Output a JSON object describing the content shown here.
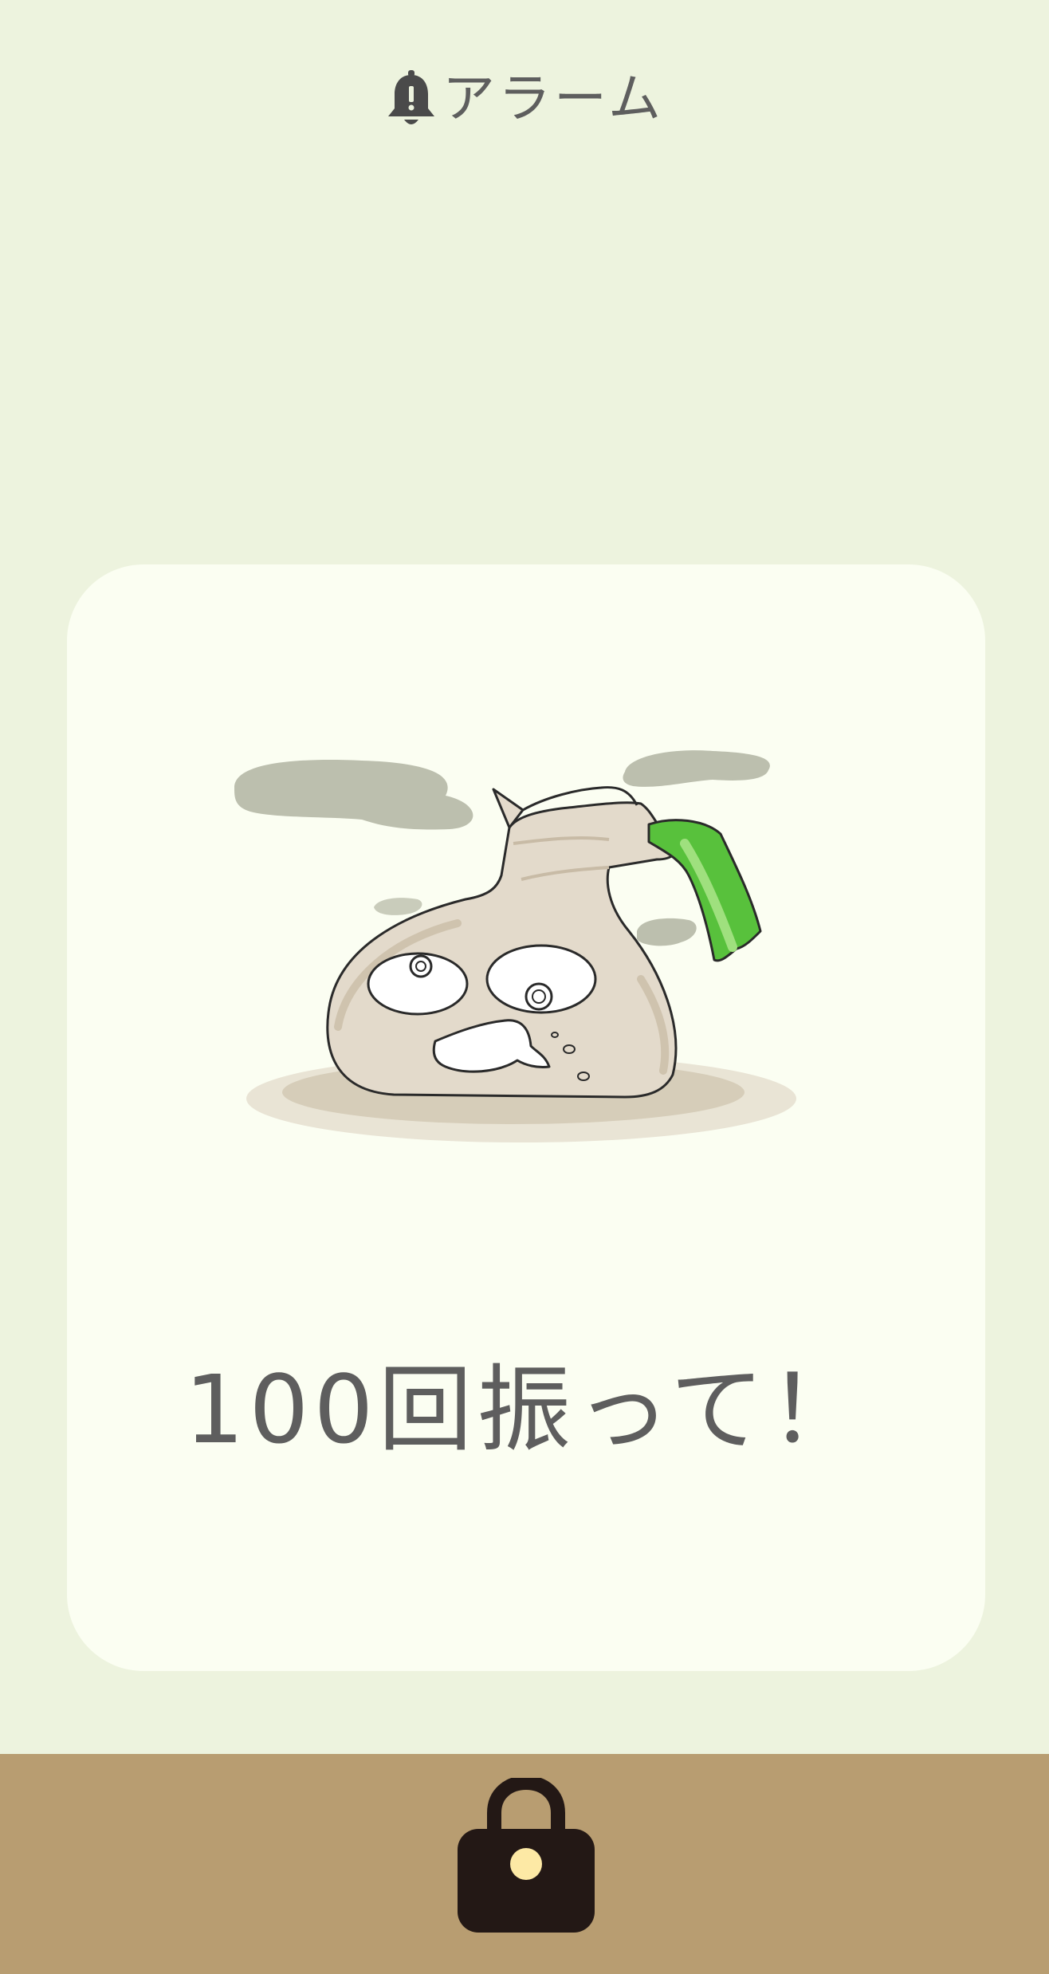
{
  "header": {
    "icon": "bell-alert-icon",
    "title": "アラーム"
  },
  "card": {
    "illustration": "smelly-garbage-bag-character",
    "message": "100回振って！"
  },
  "footer": {
    "lock_icon": "lock-icon"
  },
  "colors": {
    "background": "#edf3de",
    "card": "#fbfef2",
    "footer": "#b89d71",
    "text": "#5e5e5e",
    "lock": "#231815",
    "lock_dot": "#fde9a5"
  }
}
